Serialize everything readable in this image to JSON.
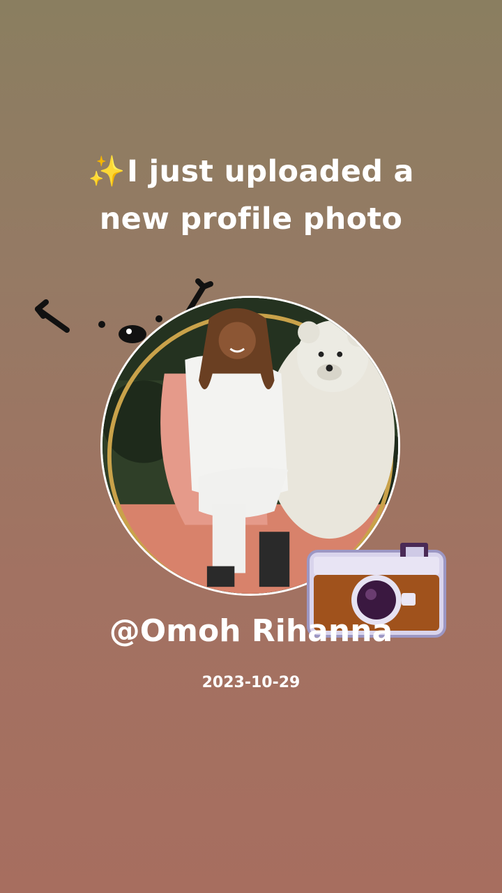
{
  "post": {
    "sparkle": "✨",
    "headline_line1": "I just uploaded a",
    "headline_line2": "new profile photo",
    "username": "@Omoh Rihanna",
    "date": "2023-10-29"
  },
  "icons": {
    "sparkle": "sparkles-icon",
    "camera": "camera-sticker-icon",
    "doodle": "doodle-face-icon"
  },
  "colors": {
    "background_top": "#8a7e60",
    "background_bottom": "#a76e5f",
    "text": "#ffffff",
    "sparkle": "#f5c842",
    "camera_body": "#a0521c"
  }
}
